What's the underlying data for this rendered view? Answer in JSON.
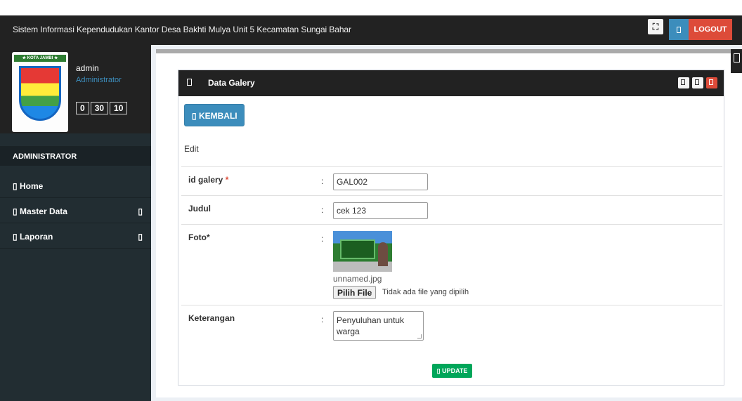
{
  "header": {
    "title": "Sistem Informasi Kependudukan Kantor Desa Bakhti Mulya Unit 5 Kecamatan Sungai Bahar",
    "logout_label": "LOGOUT",
    "user_button_icon": "user-icon",
    "expand_icon": "expand-icon",
    "expand_glyph": "⛶"
  },
  "sidebar": {
    "logo_banner": "★ KOTA JAMBI ★",
    "user_name": "admin",
    "user_role": "Administrator",
    "clock": [
      "0",
      "30",
      "10"
    ],
    "section_header": "ADMINISTRATOR",
    "items": [
      {
        "label": "Home",
        "has_children": false
      },
      {
        "label": "Master Data",
        "has_children": true
      },
      {
        "label": "Laporan",
        "has_children": true
      }
    ]
  },
  "panel": {
    "title": "Data Galery",
    "back_label": "KEMBALI",
    "section_label": "Edit",
    "fields": {
      "id_galery": {
        "label": "id galery",
        "required_mark": "*",
        "value": "GAL002"
      },
      "judul": {
        "label": "Judul",
        "value": "cek 123"
      },
      "foto": {
        "label": "Foto*",
        "current_file": "unnamed.jpg",
        "button_label": "Pilih File",
        "status": "Tidak ada file yang dipilih"
      },
      "keterangan": {
        "label": "Keterangan",
        "value": "Penyuluhan untuk warga"
      }
    },
    "colon": ":",
    "update_label": "UPDATE"
  },
  "colors": {
    "topbar": "#222222",
    "sidebar": "#222d32",
    "primary": "#3c8dbc",
    "danger": "#dd4b39",
    "success": "#00a65a"
  }
}
